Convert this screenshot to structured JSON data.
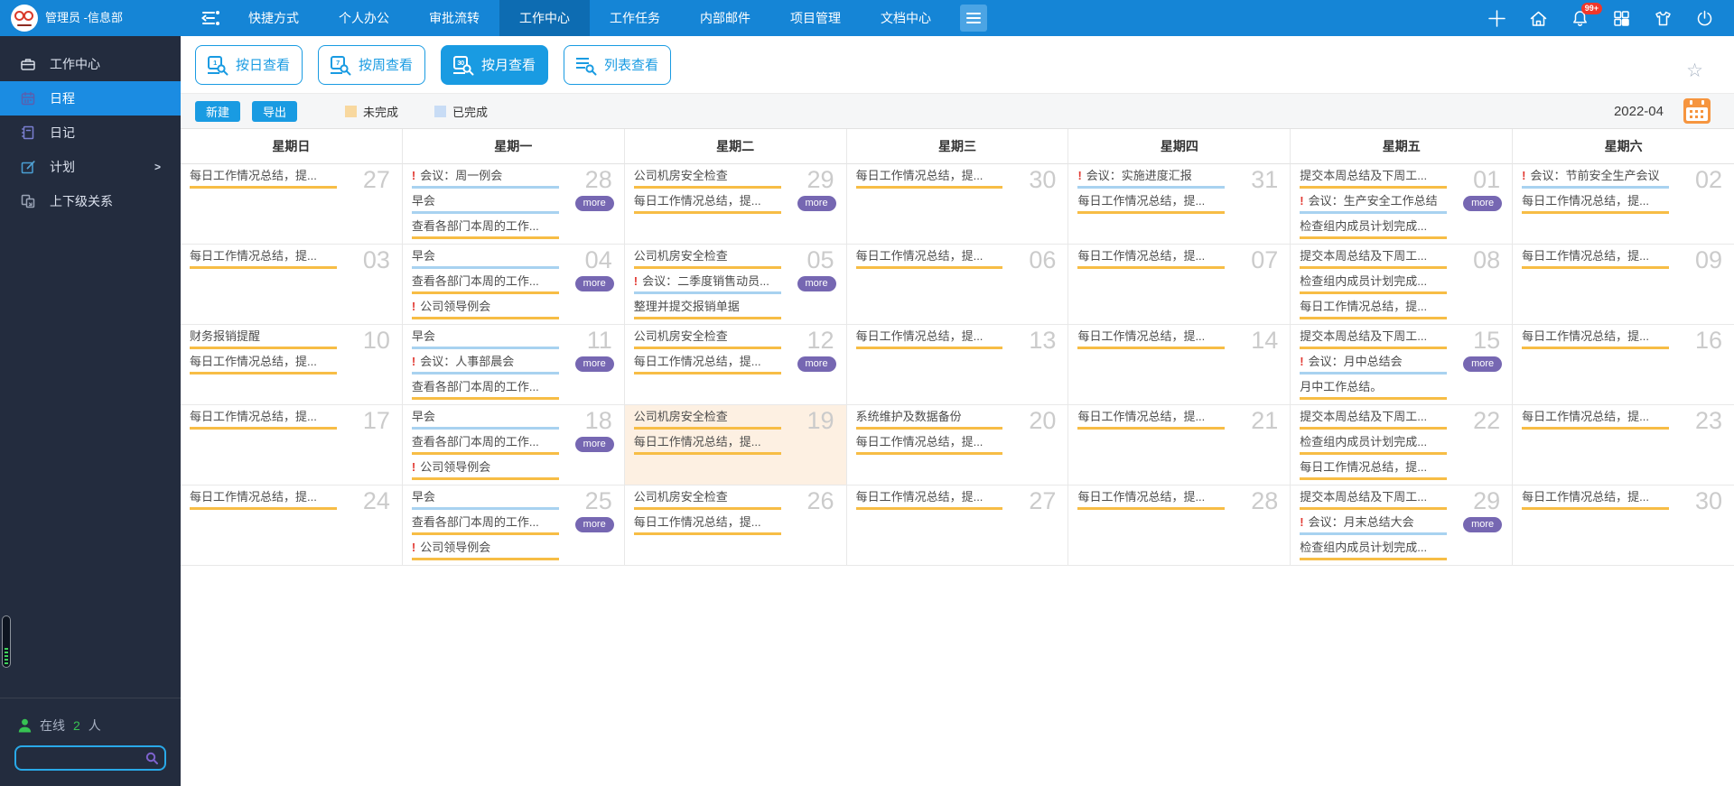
{
  "topbar": {
    "user": "管理员 -信息部",
    "badge": "99+",
    "nav": [
      {
        "label": "快捷方式",
        "active": false
      },
      {
        "label": "个人办公",
        "active": false
      },
      {
        "label": "审批流转",
        "active": false
      },
      {
        "label": "工作中心",
        "active": true
      },
      {
        "label": "工作任务",
        "active": false
      },
      {
        "label": "内部邮件",
        "active": false
      },
      {
        "label": "项目管理",
        "active": false
      },
      {
        "label": "文档中心",
        "active": false
      }
    ],
    "icons": [
      "plus-icon",
      "home-icon",
      "bell-icon",
      "grid-icon",
      "shirt-icon",
      "power-icon"
    ]
  },
  "sidebar": {
    "items": [
      {
        "label": "工作中心",
        "icon": "briefcase-icon",
        "active": false,
        "arrow": false
      },
      {
        "label": "日程",
        "icon": "schedule-icon",
        "active": true,
        "arrow": false
      },
      {
        "label": "日记",
        "icon": "diary-icon",
        "active": false,
        "arrow": false
      },
      {
        "label": "计划",
        "icon": "plan-icon",
        "active": false,
        "arrow": true
      },
      {
        "label": "上下级关系",
        "icon": "relation-icon",
        "active": false,
        "arrow": false
      }
    ],
    "online_label": "在线",
    "online_count": "2",
    "online_unit": "人"
  },
  "toolbar": {
    "views": [
      {
        "label": "按日查看",
        "icon": "calendar-search-icon",
        "icon_num": "1",
        "active": false
      },
      {
        "label": "按周查看",
        "icon": "calendar-search-icon",
        "icon_num": "7",
        "active": false
      },
      {
        "label": "按月查看",
        "icon": "calendar-search-icon",
        "icon_num": "30",
        "active": true
      },
      {
        "label": "列表查看",
        "icon": "list-search-icon",
        "icon_num": "",
        "active": false
      }
    ],
    "new_label": "新建",
    "export_label": "导出",
    "legend": [
      {
        "label": "未完成",
        "color": "#f8d89f"
      },
      {
        "label": "已完成",
        "color": "#c8dcf5"
      }
    ],
    "month": "2022-04",
    "accent_color": "#199be2",
    "pending_line_color": "#f7bd45",
    "done_line_color": "#a8d2f0"
  },
  "calendar": {
    "day_headers": [
      "星期日",
      "星期一",
      "星期二",
      "星期三",
      "星期四",
      "星期五",
      "星期六"
    ],
    "more_label": "more",
    "weeks": [
      {
        "days": [
          {
            "date": "27",
            "entries": [
              {
                "text": "每日工作情况总结，提...",
                "important": false,
                "done": false
              }
            ],
            "more": false,
            "today": false
          },
          {
            "date": "28",
            "entries": [
              {
                "text": "会议：周一例会",
                "important": true,
                "done": true
              },
              {
                "text": "早会",
                "important": false,
                "done": true
              },
              {
                "text": "查看各部门本周的工作...",
                "important": false,
                "done": false
              }
            ],
            "more": true,
            "today": false
          },
          {
            "date": "29",
            "entries": [
              {
                "text": "公司机房安全检查",
                "important": false,
                "done": false
              },
              {
                "text": "每日工作情况总结，提...",
                "important": false,
                "done": false
              }
            ],
            "more": true,
            "today": false
          },
          {
            "date": "30",
            "entries": [
              {
                "text": "每日工作情况总结，提...",
                "important": false,
                "done": false
              }
            ],
            "more": false,
            "today": false
          },
          {
            "date": "31",
            "entries": [
              {
                "text": "会议：实施进度汇报",
                "important": true,
                "done": true
              },
              {
                "text": "每日工作情况总结，提...",
                "important": false,
                "done": false
              }
            ],
            "more": false,
            "today": false
          },
          {
            "date": "01",
            "entries": [
              {
                "text": "提交本周总结及下周工...",
                "important": false,
                "done": false
              },
              {
                "text": "会议：生产安全工作总结",
                "important": true,
                "done": true
              },
              {
                "text": "检查组内成员计划完成...",
                "important": false,
                "done": false
              }
            ],
            "more": true,
            "today": false
          },
          {
            "date": "02",
            "entries": [
              {
                "text": "会议：节前安全生产会议",
                "important": true,
                "done": true
              },
              {
                "text": "每日工作情况总结，提...",
                "important": false,
                "done": false
              }
            ],
            "more": false,
            "today": false
          }
        ]
      },
      {
        "days": [
          {
            "date": "03",
            "entries": [
              {
                "text": "每日工作情况总结，提...",
                "important": false,
                "done": false
              }
            ],
            "more": false,
            "today": false
          },
          {
            "date": "04",
            "entries": [
              {
                "text": "早会",
                "important": false,
                "done": true
              },
              {
                "text": "查看各部门本周的工作...",
                "important": false,
                "done": false
              },
              {
                "text": "公司领导例会",
                "important": true,
                "done": false
              }
            ],
            "more": true,
            "today": false
          },
          {
            "date": "05",
            "entries": [
              {
                "text": "公司机房安全检查",
                "important": false,
                "done": false
              },
              {
                "text": "会议：二季度销售动员...",
                "important": true,
                "done": true
              },
              {
                "text": "整理并提交报销单据",
                "important": false,
                "done": false
              }
            ],
            "more": true,
            "today": false
          },
          {
            "date": "06",
            "entries": [
              {
                "text": "每日工作情况总结，提...",
                "important": false,
                "done": false
              }
            ],
            "more": false,
            "today": false
          },
          {
            "date": "07",
            "entries": [
              {
                "text": "每日工作情况总结，提...",
                "important": false,
                "done": false
              }
            ],
            "more": false,
            "today": false
          },
          {
            "date": "08",
            "entries": [
              {
                "text": "提交本周总结及下周工...",
                "important": false,
                "done": false
              },
              {
                "text": "检查组内成员计划完成...",
                "important": false,
                "done": false
              },
              {
                "text": "每日工作情况总结，提...",
                "important": false,
                "done": false
              }
            ],
            "more": false,
            "today": false
          },
          {
            "date": "09",
            "entries": [
              {
                "text": "每日工作情况总结，提...",
                "important": false,
                "done": false
              }
            ],
            "more": false,
            "today": false
          }
        ]
      },
      {
        "days": [
          {
            "date": "10",
            "entries": [
              {
                "text": "财务报销提醒",
                "important": false,
                "done": false
              },
              {
                "text": "每日工作情况总结，提...",
                "important": false,
                "done": false
              }
            ],
            "more": false,
            "today": false
          },
          {
            "date": "11",
            "entries": [
              {
                "text": "早会",
                "important": false,
                "done": true
              },
              {
                "text": "会议：人事部晨会",
                "important": true,
                "done": true
              },
              {
                "text": "查看各部门本周的工作...",
                "important": false,
                "done": false
              }
            ],
            "more": true,
            "today": false
          },
          {
            "date": "12",
            "entries": [
              {
                "text": "公司机房安全检查",
                "important": false,
                "done": false
              },
              {
                "text": "每日工作情况总结，提...",
                "important": false,
                "done": false
              }
            ],
            "more": true,
            "today": false
          },
          {
            "date": "13",
            "entries": [
              {
                "text": "每日工作情况总结，提...",
                "important": false,
                "done": false
              }
            ],
            "more": false,
            "today": false
          },
          {
            "date": "14",
            "entries": [
              {
                "text": "每日工作情况总结，提...",
                "important": false,
                "done": false
              }
            ],
            "more": false,
            "today": false
          },
          {
            "date": "15",
            "entries": [
              {
                "text": "提交本周总结及下周工...",
                "important": false,
                "done": false
              },
              {
                "text": "会议：月中总结会",
                "important": true,
                "done": true
              },
              {
                "text": "月中工作总结。",
                "important": false,
                "done": false
              }
            ],
            "more": true,
            "today": false
          },
          {
            "date": "16",
            "entries": [
              {
                "text": "每日工作情况总结，提...",
                "important": false,
                "done": false
              }
            ],
            "more": false,
            "today": false
          }
        ]
      },
      {
        "days": [
          {
            "date": "17",
            "entries": [
              {
                "text": "每日工作情况总结，提...",
                "important": false,
                "done": false
              }
            ],
            "more": false,
            "today": false
          },
          {
            "date": "18",
            "entries": [
              {
                "text": "早会",
                "important": false,
                "done": true
              },
              {
                "text": "查看各部门本周的工作...",
                "important": false,
                "done": false
              },
              {
                "text": "公司领导例会",
                "important": true,
                "done": false
              }
            ],
            "more": true,
            "today": false
          },
          {
            "date": "19",
            "entries": [
              {
                "text": "公司机房安全检查",
                "important": false,
                "done": false
              },
              {
                "text": "每日工作情况总结，提...",
                "important": false,
                "done": false
              }
            ],
            "more": false,
            "today": true
          },
          {
            "date": "20",
            "entries": [
              {
                "text": "系统维护及数据备份",
                "important": false,
                "done": false
              },
              {
                "text": "每日工作情况总结，提...",
                "important": false,
                "done": false
              }
            ],
            "more": false,
            "today": false
          },
          {
            "date": "21",
            "entries": [
              {
                "text": "每日工作情况总结，提...",
                "important": false,
                "done": false
              }
            ],
            "more": false,
            "today": false
          },
          {
            "date": "22",
            "entries": [
              {
                "text": "提交本周总结及下周工...",
                "important": false,
                "done": false
              },
              {
                "text": "检查组内成员计划完成...",
                "important": false,
                "done": false
              },
              {
                "text": "每日工作情况总结，提...",
                "important": false,
                "done": false
              }
            ],
            "more": false,
            "today": false
          },
          {
            "date": "23",
            "entries": [
              {
                "text": "每日工作情况总结，提...",
                "important": false,
                "done": false
              }
            ],
            "more": false,
            "today": false
          }
        ]
      },
      {
        "days": [
          {
            "date": "24",
            "entries": [
              {
                "text": "每日工作情况总结，提...",
                "important": false,
                "done": false
              }
            ],
            "more": false,
            "today": false
          },
          {
            "date": "25",
            "entries": [
              {
                "text": "早会",
                "important": false,
                "done": true
              },
              {
                "text": "查看各部门本周的工作...",
                "important": false,
                "done": false
              },
              {
                "text": "公司领导例会",
                "important": true,
                "done": false
              }
            ],
            "more": true,
            "today": false
          },
          {
            "date": "26",
            "entries": [
              {
                "text": "公司机房安全检查",
                "important": false,
                "done": false
              },
              {
                "text": "每日工作情况总结，提...",
                "important": false,
                "done": false
              }
            ],
            "more": false,
            "today": false
          },
          {
            "date": "27",
            "entries": [
              {
                "text": "每日工作情况总结，提...",
                "important": false,
                "done": false
              }
            ],
            "more": false,
            "today": false
          },
          {
            "date": "28",
            "entries": [
              {
                "text": "每日工作情况总结，提...",
                "important": false,
                "done": false
              }
            ],
            "more": false,
            "today": false
          },
          {
            "date": "29",
            "entries": [
              {
                "text": "提交本周总结及下周工...",
                "important": false,
                "done": false
              },
              {
                "text": "会议：月末总结大会",
                "important": true,
                "done": true
              },
              {
                "text": "检查组内成员计划完成...",
                "important": false,
                "done": false
              }
            ],
            "more": true,
            "today": false
          },
          {
            "date": "30",
            "entries": [
              {
                "text": "每日工作情况总结，提...",
                "important": false,
                "done": false
              }
            ],
            "more": false,
            "today": false
          }
        ]
      }
    ]
  }
}
